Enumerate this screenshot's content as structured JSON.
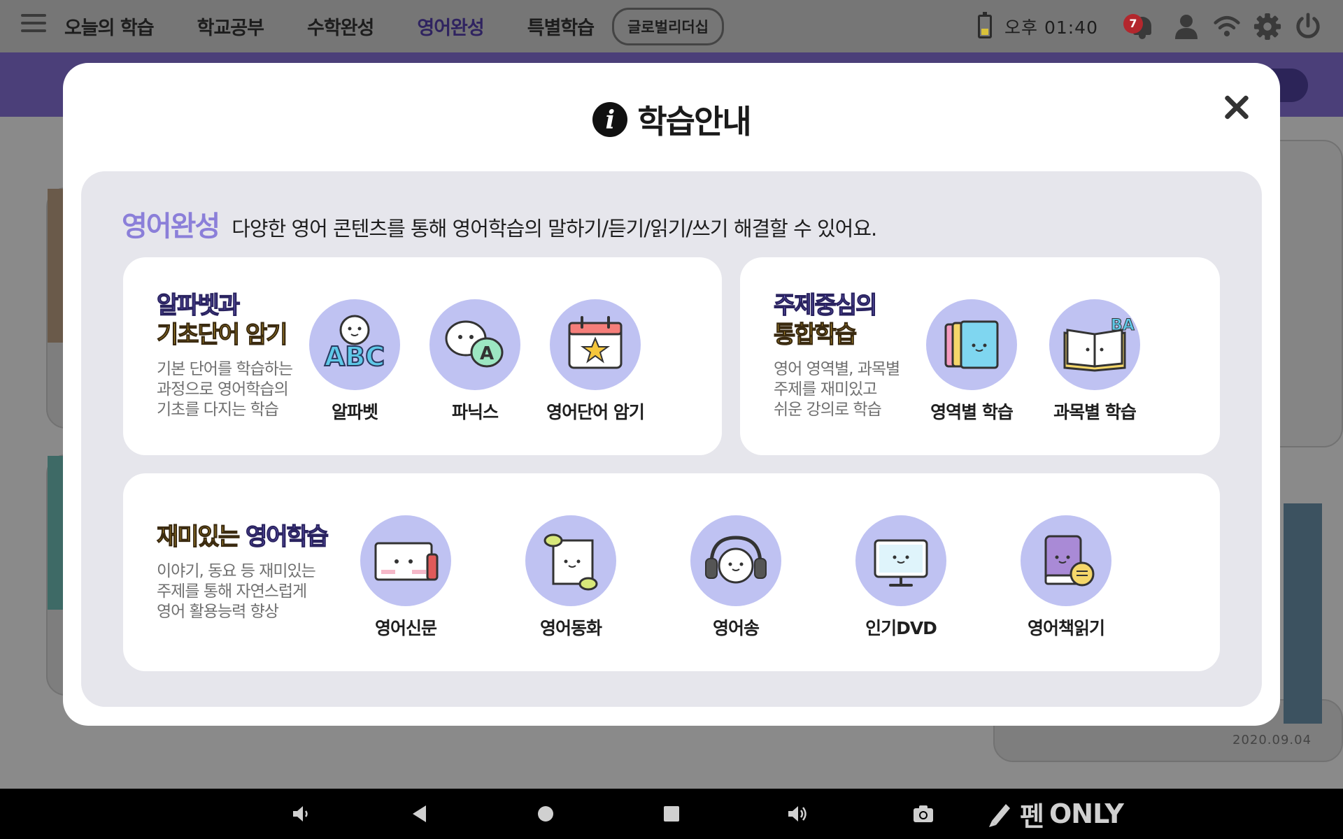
{
  "topbar": {
    "nav": [
      "오늘의 학습",
      "학교공부",
      "수학완성",
      "영어완성",
      "특별학습"
    ],
    "pill": "글로벌리더십",
    "clock": "오후 01:40",
    "notification_count": "7"
  },
  "background": {
    "date": "2020.09.04"
  },
  "modal": {
    "title": "학습안내",
    "section_title": "영어완성",
    "section_desc": "다양한 영어 콘텐츠를 통해 영어학습의 말하기/듣기/읽기/쓰기 해결할 수 있어요.",
    "card1": {
      "head_line1": "알파벳과",
      "head_line2": "기초단어 암기",
      "desc": "기본 단어를 학습하는\n과정으로 영어학습의\n기초를 다지는 학습",
      "items": [
        "알파벳",
        "파닉스",
        "영어단어 암기"
      ]
    },
    "card2": {
      "head_line1": "주제중심의",
      "head_line2": "통합학습",
      "desc": "영어 영역별, 과목별\n주제를 재미있고\n쉬운 강의로 학습",
      "items": [
        "영역별 학습",
        "과목별 학습"
      ]
    },
    "card3": {
      "head_part1": "재미있는",
      "head_part2": "영어학습",
      "desc": "이야기, 동요 등 재미있는\n주제를 통해 자연스럽게\n영어 활용능력 향상",
      "items": [
        "영어신문",
        "영어동화",
        "영어송",
        "인기DVD",
        "영어책읽기"
      ]
    }
  },
  "navbar": {
    "pen_label": "펜",
    "pen_only": "ONLY"
  },
  "colors": {
    "accent_purple": "#8b7fd9",
    "icon_circle": "#bfc2f2",
    "head_yellow": "#f5c63c",
    "badge_red": "#b3272d"
  }
}
